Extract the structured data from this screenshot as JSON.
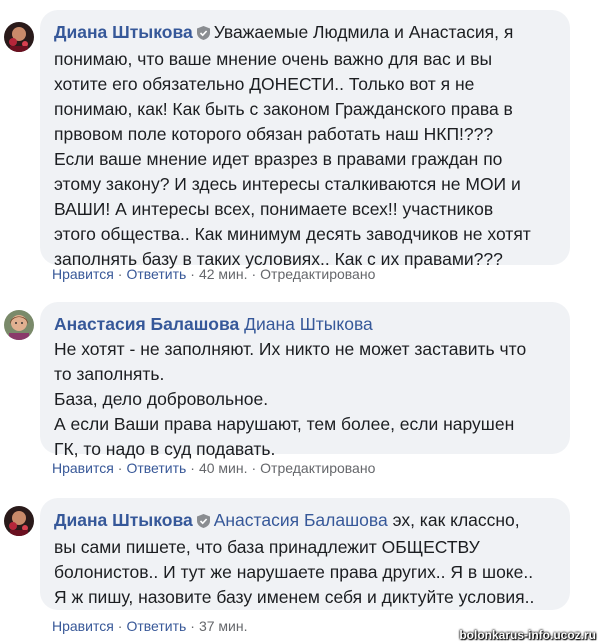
{
  "comments": [
    {
      "author": "Диана Штыкова",
      "mention": "",
      "lines": [
        "Уважаемые Людмила и Анастасия, я",
        "понимаю, что ваше мнение очень важно для вас и вы",
        "хотите его обязательно ДОНЕСТИ.. Только вот я не",
        "понимаю, как! Как быть с законом Гражданского права в",
        "првовом поле которого обязан работать наш НКП!???",
        "Если ваше мнение идет вразрез в правами граждан по",
        "этому закону? И здесь интересы сталкиваются не МОИ и",
        "ВАШИ! А интересы всех, понимаете всех!! участников",
        "этого общества.. Как минимум десять заводчиков не хотят",
        "заполнять базу в таких условиях.. Как с их правами???"
      ],
      "like": "Нравится",
      "reply": "Ответить",
      "time": "42 мин.",
      "edited": "Отредактировано"
    },
    {
      "author": "Анастасия Балашова",
      "mention": "Диана Штыкова",
      "lines": [
        "Не хотят - не заполняют. Их никто не может заставить что",
        "то заполнять.",
        "База, дело добровольное.",
        "А если Ваши права нарушают, тем более, если нарушен",
        "ГК, то надо в суд подавать."
      ],
      "like": "Нравится",
      "reply": "Ответить",
      "time": "40 мин.",
      "edited": "Отредактировано"
    },
    {
      "author": "Диана Штыкова",
      "mention": "Анастасия Балашова",
      "lines": [
        "эх, как классно,",
        "вы сами пишете, что база принадлежит ОБЩЕСТВУ",
        "болонистов.. И тут же нарушаете права других.. Я в шоке..",
        "Я ж пишу, назовите базу именем себя и диктуйте условия.."
      ],
      "like": "Нравится",
      "reply": "Ответить",
      "time": "37 мин."
    }
  ],
  "watermark": "bolonkarus-info.ucoz.ru",
  "colors": {
    "bubble": "#f0f2f5",
    "link": "#365899",
    "meta": "#65676b"
  },
  "icons": {
    "verified": "shield-icon"
  }
}
